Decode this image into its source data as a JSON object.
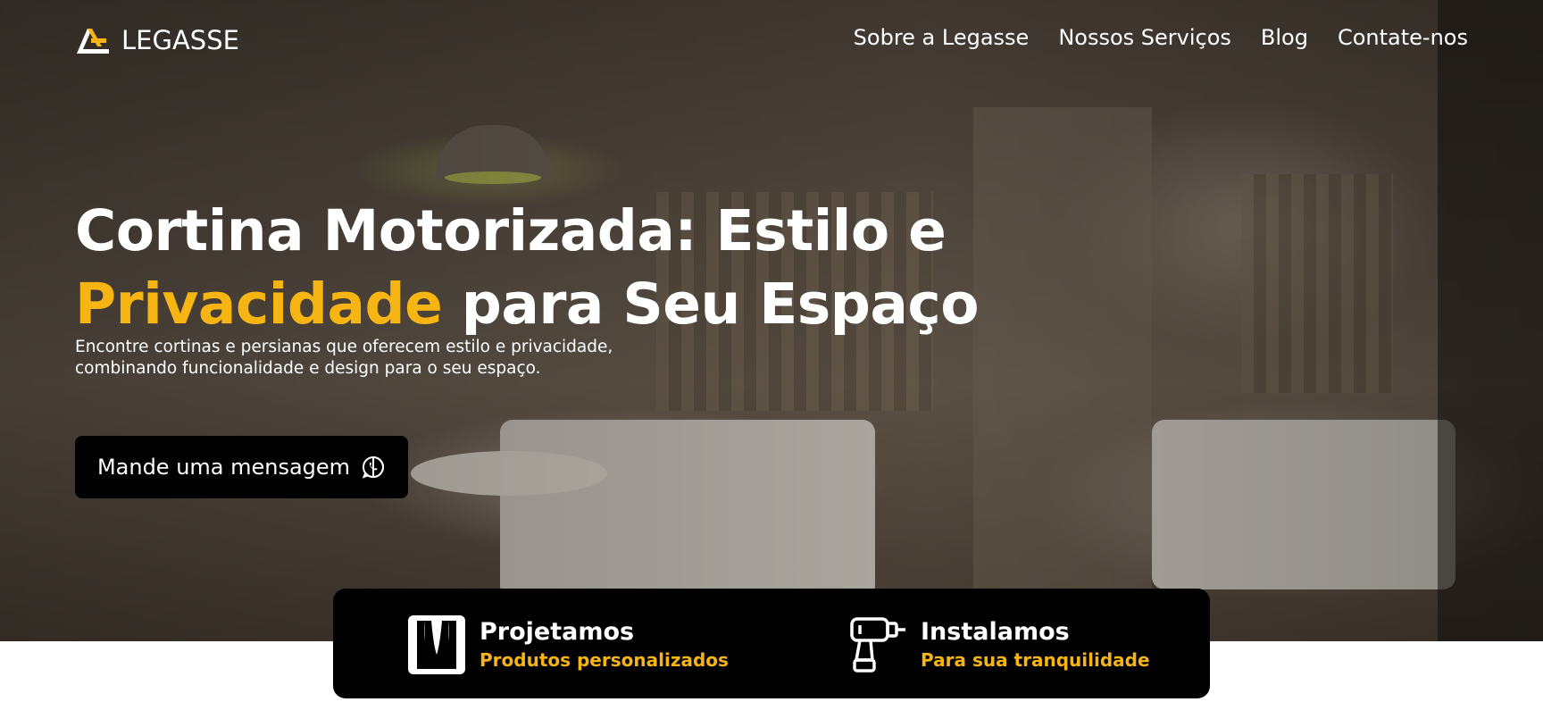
{
  "brand": {
    "name": "LEGASSE",
    "accent_color": "#f7b514",
    "logo_icon": "legasse-logo-icon"
  },
  "nav": {
    "items": [
      {
        "label": "Sobre a Legasse"
      },
      {
        "label": "Nossos Serviços"
      },
      {
        "label": "Blog"
      },
      {
        "label": "Contate-nos"
      }
    ]
  },
  "hero": {
    "headline_part1": "Cortina Motorizada: Estilo e",
    "headline_accent": "Privacidade",
    "headline_part2": " para Seu Espaço",
    "subtitle_line1": "Encontre cortinas e persianas que oferecem estilo e privacidade,",
    "subtitle_line2": "combinando funcionalidade e design para o seu espaço.",
    "cta_label": "Mande uma mensagem",
    "cta_icon": "whatsapp-icon"
  },
  "features": [
    {
      "title": "Projetamos",
      "subtitle": "Produtos personalizados",
      "icon": "curtain-icon"
    },
    {
      "title": "Instalamos",
      "subtitle": "Para sua tranquilidade",
      "icon": "drill-icon"
    }
  ]
}
